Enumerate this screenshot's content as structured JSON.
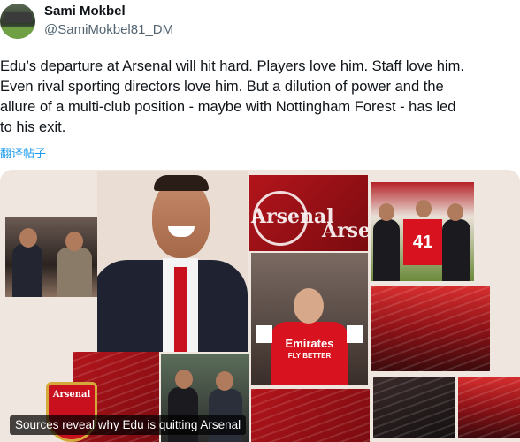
{
  "author": {
    "name": "Sami Mokbel",
    "handle": "@SamiMokbel81_DM",
    "avatar_icon": "avatar-photo"
  },
  "tweet": {
    "lines": [
      "Edu’s departure at Arsenal will hit hard. Players love him. Staff love him.",
      "Even rival sporting directors love him. But a dilution of power and the",
      "allure of a multi-club position - maybe with Nottingham Forest - has led",
      "to his exit."
    ],
    "translate_label": "翻译帖子"
  },
  "media": {
    "caption": "Sources reveal why Edu is quitting Arsenal",
    "texts": {
      "arsenal_1": "Arsenal",
      "arsenal_2": "Arsen",
      "arsenal_crest": "Arsenal",
      "jersey_sponsor_1": "Emirates",
      "jersey_sponsor_2": "FLY BETTER",
      "shirt_number": "41"
    }
  },
  "colors": {
    "link": "#1d9bf0",
    "secondary_text": "#536471",
    "arsenal_red": "#c8101e"
  }
}
